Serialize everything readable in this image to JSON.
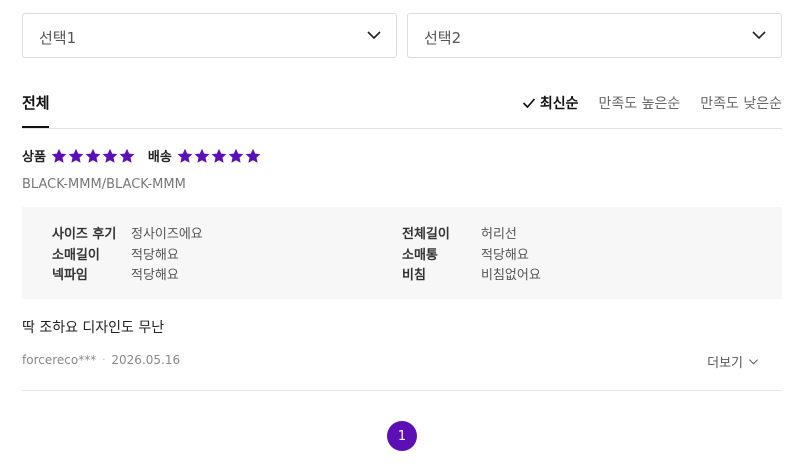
{
  "filters": {
    "select1": "선택1",
    "select2": "선택2"
  },
  "tabs": {
    "all_label": "전체"
  },
  "sort": {
    "options": [
      "최신순",
      "만족도 높은순",
      "만족도 낮은순"
    ],
    "active": "최신순"
  },
  "review": {
    "ratings": [
      {
        "label": "상품",
        "stars": 5
      },
      {
        "label": "배송",
        "stars": 5
      }
    ],
    "option": "BLACK-MMM/BLACK-MMM",
    "fit": [
      {
        "key": "사이즈 후기",
        "value": "정사이즈에요"
      },
      {
        "key": "소매길이",
        "value": "적당해요"
      },
      {
        "key": "넥파임",
        "value": "적당해요"
      },
      {
        "key": "전체길이",
        "value": "허리선"
      },
      {
        "key": "소매통",
        "value": "적당해요"
      },
      {
        "key": "비침",
        "value": "비침없어요"
      }
    ],
    "text": "딱 조하요 디자인도 무난",
    "author": "forcereco***",
    "date": "2026.05.16",
    "more_label": "더보기"
  },
  "pagination": {
    "current": "1"
  },
  "colors": {
    "accent": "#5b0fb4",
    "fit_bg": "#f7f7f7"
  },
  "icons": {
    "dropdown": "chevron-down-icon",
    "sort_active": "check-icon",
    "rating": "star-icon"
  }
}
